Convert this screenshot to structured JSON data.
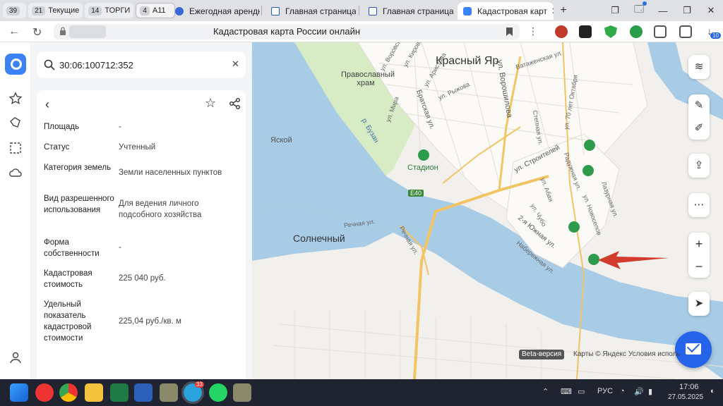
{
  "browser": {
    "tab_groups": [
      {
        "count": "39",
        "label": ""
      },
      {
        "count": "21",
        "label": "Текущие"
      },
      {
        "count": "14",
        "label": "ТОРГИ"
      },
      {
        "count": "4",
        "label": "А11"
      }
    ],
    "tabs": [
      {
        "label": "Ежегодная арендна",
        "active": false
      },
      {
        "label": "Главная страница",
        "active": false
      },
      {
        "label": "Главная страница",
        "active": false
      },
      {
        "label": "Кадастровая карт",
        "active": true
      }
    ],
    "page_title": "Кадастровая карта России онлайн",
    "extension_badge": "10"
  },
  "search": {
    "value": "30:06:100712:352"
  },
  "details": [
    {
      "label": "Площадь",
      "value": "-"
    },
    {
      "label": "Статус",
      "value": "Учтенный"
    },
    {
      "label": "Категория земель",
      "value": "Земли населенных пунктов"
    },
    {
      "label": "Вид разрешенного использования",
      "value": "Для ведения личного подсобного хозяйства"
    },
    {
      "label": "Форма собственности",
      "value": "-"
    },
    {
      "label": "Кадастровая стоимость",
      "value": "225 040 руб."
    },
    {
      "label": "Удельный показатель кадастровой стоимости",
      "value": "225,04 руб./кв. м"
    }
  ],
  "map": {
    "labels": {
      "city": "Красный Яр",
      "district": "Солнечный",
      "church": "Православный храм",
      "stadium": "Стадион",
      "river": "р. Бузан",
      "road_badge": "E40",
      "fragment": "Яской",
      "streets": [
        "ул. Воровского",
        "ул. Кирова",
        "ул. Аристова",
        "ул. Мира",
        "Братская ул.",
        "ул. Рыжова",
        "ул. Ворошилова",
        "Ватаженская ул.",
        "ул. 70 лет Октября",
        "Степная ул.",
        "ул. Строителей",
        "Радужная ул.",
        "ул. Абая",
        "Лазурная ул.",
        "ул. Новоселов",
        "ул. Чубо",
        "2-я Южная ул.",
        "Набережная ул.",
        "Речная ул.",
        "Речная ул."
      ]
    },
    "beta": "Beta-версия",
    "attribution": "Карты © Яндекс",
    "terms": "Условия исполь"
  },
  "taskbar": {
    "lang": "РУС",
    "time": "17:06",
    "date": "27.05.2025",
    "telegram_badge": "33"
  }
}
